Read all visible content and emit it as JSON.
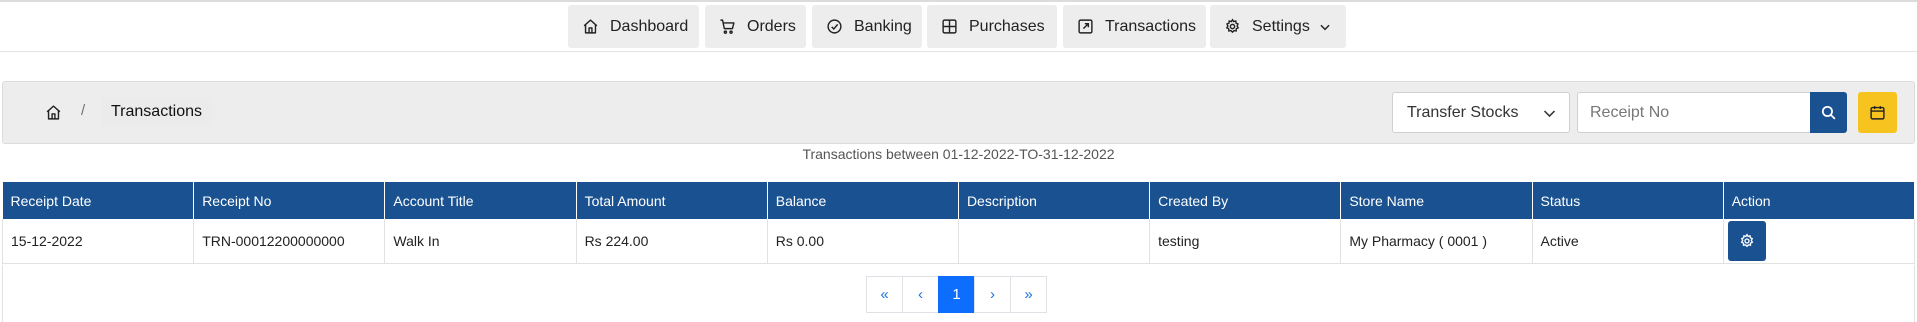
{
  "nav": {
    "items": [
      {
        "label": "Dashboard",
        "icon": "home-icon"
      },
      {
        "label": "Orders",
        "icon": "cart-icon"
      },
      {
        "label": "Banking",
        "icon": "check-circle-icon"
      },
      {
        "label": "Purchases",
        "icon": "grid-icon"
      },
      {
        "label": "Transactions",
        "icon": "external-link-icon"
      },
      {
        "label": "Settings",
        "icon": "gear-icon"
      }
    ]
  },
  "breadcrumb": {
    "separator": "/",
    "current": "Transactions"
  },
  "filter": {
    "selected": "Transfer Stocks",
    "search_placeholder": "Receipt No"
  },
  "range_text": "Transactions between 01-12-2022-TO-31-12-2022",
  "table": {
    "headers": [
      "Receipt Date",
      "Receipt No",
      "Account Title",
      "Total Amount",
      "Balance",
      "Description",
      "Created By",
      "Store Name",
      "Status",
      "Action"
    ],
    "rows": [
      [
        "15-12-2022",
        "TRN-00012200000000",
        "Walk In",
        "Rs 224.00",
        "Rs 0.00",
        "",
        "testing",
        "My Pharmacy ( 0001 )",
        "Active"
      ]
    ]
  },
  "pagination": {
    "first": "«",
    "prev": "‹",
    "current": "1",
    "next": "›",
    "last": "»"
  },
  "colors": {
    "primary": "#1a5291",
    "accent": "#f7c41f",
    "page_active": "#0d6efd"
  }
}
